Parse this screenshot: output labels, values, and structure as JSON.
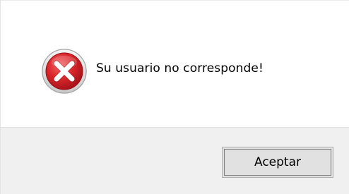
{
  "dialog": {
    "icon": "error-icon",
    "message": "Su usuario no corresponde!",
    "buttons": {
      "ok_label": "Aceptar"
    }
  },
  "colors": {
    "icon_red": "#d8262b",
    "footer_bg": "#f0f0f0",
    "button_bg": "#e1e1e1"
  }
}
